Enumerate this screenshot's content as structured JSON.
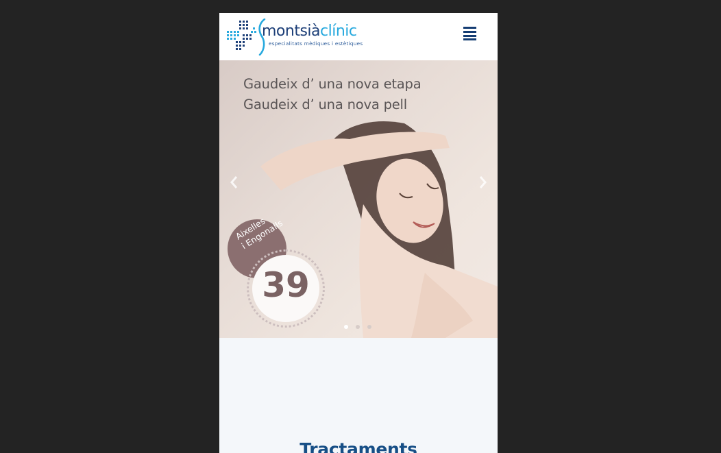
{
  "colors": {
    "page_background": "#232323",
    "header_background": "#ffffff",
    "brand_navy": "#1d3f78",
    "brand_cyan": "#27a9de",
    "menu_icon": "#153d73",
    "section_title": "#174f86",
    "badge": "#8b6f70",
    "dot_active": "#ffffff",
    "dot_inactive": "#d7ccc8"
  },
  "header": {
    "logo": {
      "name_part1": "montsià",
      "name_part2": "clínic",
      "tagline": "especialitats mèdiques i estètiques"
    },
    "menu_icon": "hamburger-menu-icon"
  },
  "hero": {
    "headline_line1": "Gaudeix d’ una nova etapa",
    "headline_line2": "Gaudeix d’ una nova pell",
    "badge_line1": "Aixelles",
    "badge_line2": "i Engonalls",
    "price": "39",
    "prev_icon": "chevron-left-icon",
    "next_icon": "chevron-right-icon",
    "slides_total": 3,
    "active_slide": 1
  },
  "section": {
    "title": "Tractaments"
  }
}
